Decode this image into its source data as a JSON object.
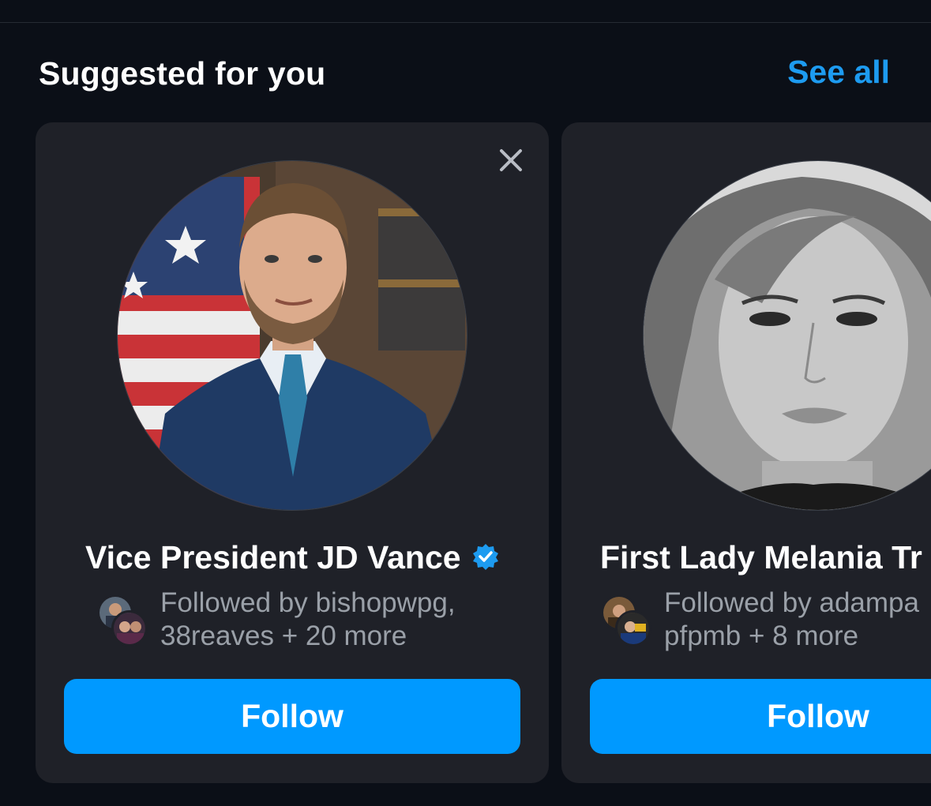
{
  "section": {
    "title": "Suggested for you",
    "see_all_label": "See all"
  },
  "cards": [
    {
      "name": "Vice President JD Vance",
      "verified": true,
      "followed_by_line1": "Followed by bishopwpg,",
      "followed_by_line2": "38reaves + 20 more",
      "follow_label": "Follow",
      "close_icon": "close-icon"
    },
    {
      "name": "First Lady Melania Tr",
      "verified": false,
      "followed_by_line1": "Followed by adampa",
      "followed_by_line2": "pfpmb + 8 more",
      "follow_label": "Follow"
    }
  ],
  "colors": {
    "background": "#0b0f17",
    "card": "#1f2128",
    "accent": "#1d9bf0",
    "button": "#0099ff",
    "muted_text": "#9aa0a8"
  }
}
